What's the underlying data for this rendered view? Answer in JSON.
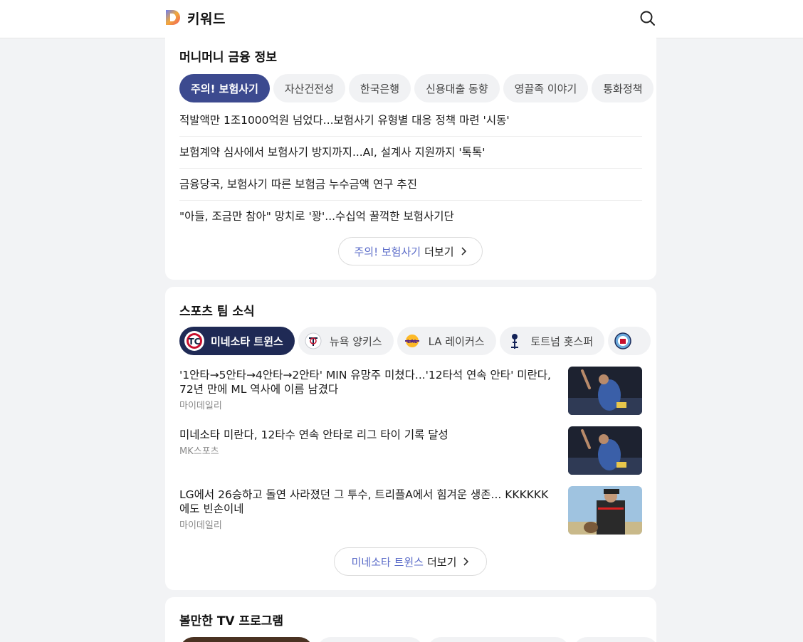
{
  "header": {
    "brand": "키워드"
  },
  "finance": {
    "title": "머니머니 금융 정보",
    "chips": [
      "주의! 보험사기",
      "자산건전성",
      "한국은행",
      "신용대출 동향",
      "영끌족 이야기",
      "통화정책"
    ],
    "news": [
      "적발액만 1조1000억원 넘었다...보험사기 유형별 대응 정책 마련 '시동'",
      "보험계약 심사에서 보험사기 방지까지...AI, 설계사 지원까지 '톡톡'",
      "금융당국, 보험사기 따른 보험금 누수금액 연구 추진",
      "\"아들, 조금만 참아\" 망치로 '꽝'...수십억 꿀꺽한 보험사기단"
    ],
    "more": {
      "topic": "주의! 보험사기",
      "label": "더보기"
    }
  },
  "sports": {
    "title": "스포츠 팀 소식",
    "chips": [
      "미네소타 트윈스",
      "뉴욕 양키스",
      "LA 레이커스",
      "토트넘 홋스퍼",
      ""
    ],
    "news": [
      {
        "headline": "'1안타→5안타→4안타→2안타' MIN 유망주 미쳤다...'12타석 연속 안타' 미란다, 72년 만에 ML 역사에 이름 남겼다",
        "source": "마이데일리"
      },
      {
        "headline": "미네소타 미란다, 12타수 연속 안타로 리그 타이 기록 달성",
        "source": "MK스포츠"
      },
      {
        "headline": "LG에서 26승하고 돌연 사라졌던 그 투수, 트리플A에서 힘겨운 생존... KKKKKK에도 빈손이네",
        "source": "마이데일리"
      }
    ],
    "more": {
      "topic": "미네소타 트윈스",
      "label": "더보기"
    }
  },
  "tv": {
    "title": "볼만한 TV 프로그램"
  },
  "colors": {
    "finance_active": "#3c4a8f",
    "sports_active": "#1f2a55",
    "accent_text": "#5a6bc8"
  }
}
